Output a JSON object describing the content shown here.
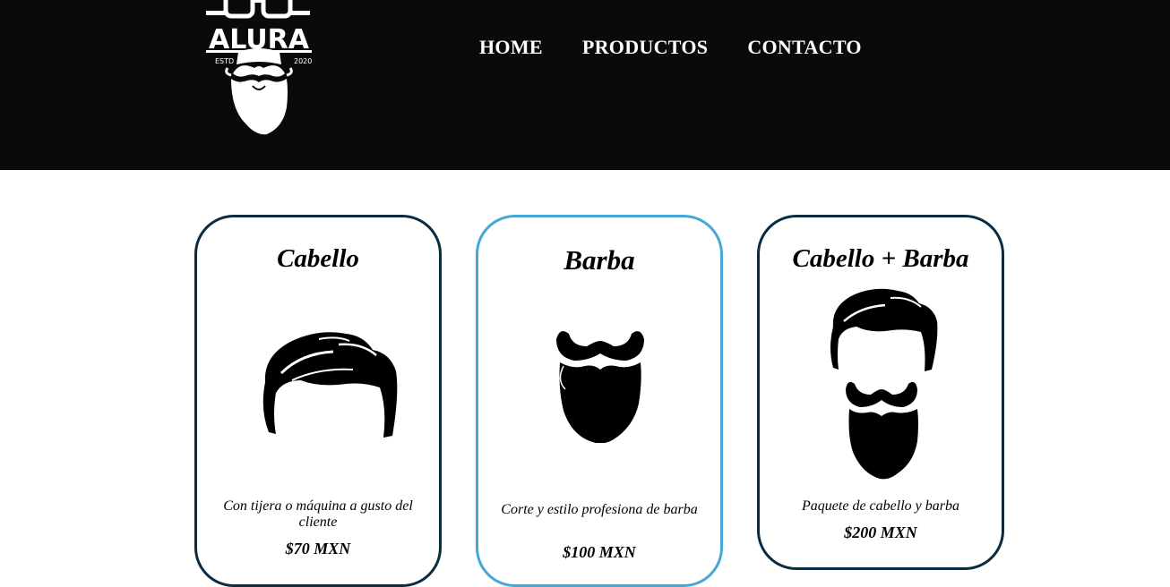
{
  "header": {
    "logo": {
      "brand": "ALURA",
      "left_text": "ESTD",
      "right_text": "2020",
      "icon": "bearded-man-logo-icon"
    },
    "nav": [
      {
        "label": "HOME"
      },
      {
        "label": "PRODUCTOS"
      },
      {
        "label": "CONTACTO"
      }
    ]
  },
  "products": [
    {
      "title": "Cabello",
      "icon": "hair-icon",
      "description": "Con tijera o máquina a gusto del cliente",
      "price": "$70 MXN"
    },
    {
      "title": "Barba",
      "icon": "beard-icon",
      "description": "Corte y estilo profesiona de barba",
      "price": "$100 MXN"
    },
    {
      "title": "Cabello + Barba",
      "icon": "hair-and-beard-icon",
      "description": "Paquete de cabello y barba",
      "price": "$200 MXN"
    }
  ],
  "colors": {
    "header_bg": "#0a0a0a",
    "card_border": "#0d2b40",
    "card_border_highlight": "#46a6d6"
  }
}
